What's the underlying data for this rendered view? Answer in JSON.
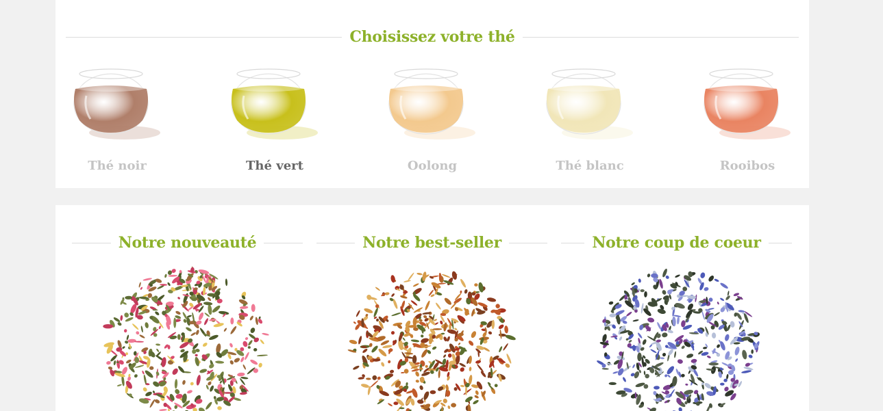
{
  "choose_section": {
    "title": "Choisissez votre thé",
    "teas": [
      {
        "label": "Thé noir",
        "icon": "black-tea-cup-icon",
        "liquid_color": "#b07f6a",
        "selected": false
      },
      {
        "label": "Thé vert",
        "icon": "green-tea-cup-icon",
        "liquid_color": "#c8c01c",
        "selected": true
      },
      {
        "label": "Oolong",
        "icon": "oolong-tea-cup-icon",
        "liquid_color": "#f3c98e",
        "selected": false
      },
      {
        "label": "Thé blanc",
        "icon": "white-tea-cup-icon",
        "liquid_color": "#f1e6b8",
        "selected": false
      },
      {
        "label": "Rooibos",
        "icon": "rooibos-tea-cup-icon",
        "liquid_color": "#e98462",
        "selected": false
      }
    ]
  },
  "featured_section": {
    "items": [
      {
        "title": "Notre nouveauté",
        "image": "green-tea-rose-blend-image"
      },
      {
        "title": "Notre best-seller",
        "image": "fruit-infusion-blend-image"
      },
      {
        "title": "Notre coup de coeur",
        "image": "black-tea-cornflower-blend-image"
      }
    ]
  },
  "colors": {
    "accent": "#8db12a",
    "background": "#f1f1f1",
    "panel": "#ffffff",
    "label_inactive": "#c4c4c4",
    "label_active": "#666666"
  }
}
